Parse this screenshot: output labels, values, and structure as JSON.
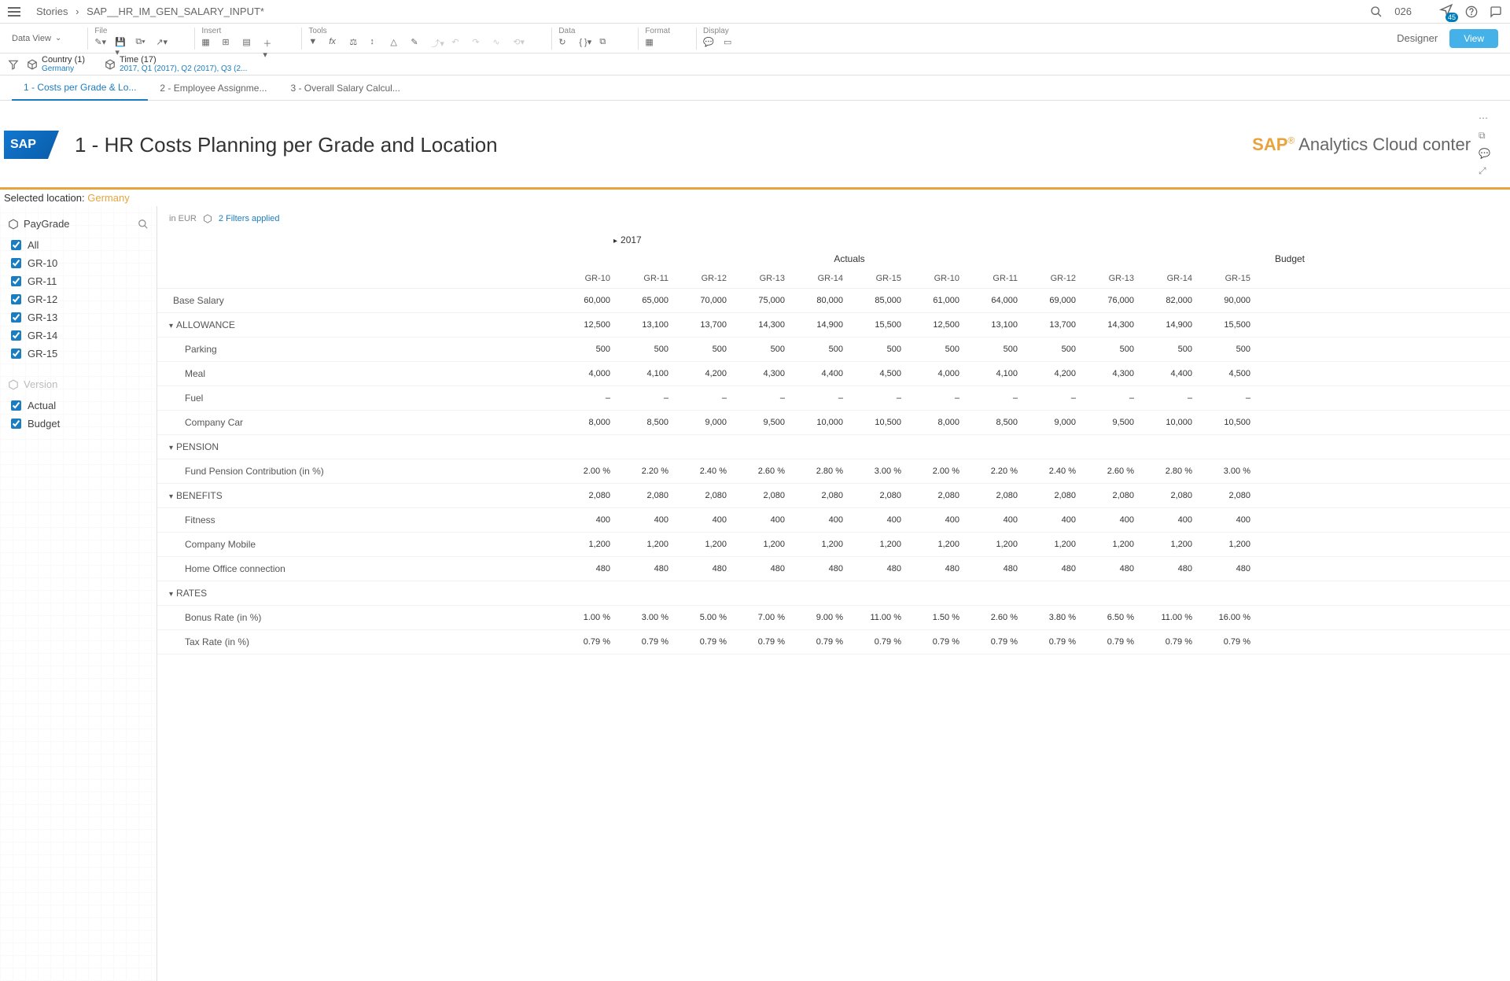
{
  "breadcrumb": {
    "root": "Stories",
    "current": "SAP__HR_IM_GEN_SALARY_INPUT*"
  },
  "search_value": "026",
  "notif_count": "45",
  "toolbar": {
    "data_view": "Data View",
    "groups": {
      "file": "File",
      "insert": "Insert",
      "tools": "Tools",
      "data": "Data",
      "format": "Format",
      "display": "Display"
    },
    "designer": "Designer",
    "view_btn": "View"
  },
  "filters": {
    "country": {
      "label": "Country (1)",
      "value": "Germany"
    },
    "time": {
      "label": "Time (17)",
      "value": "2017, Q1 (2017), Q2 (2017), Q3 (2..."
    }
  },
  "tabs": [
    {
      "label": "1 - Costs per Grade & Lo...",
      "active": true
    },
    {
      "label": "2 - Employee Assignme..."
    },
    {
      "label": "3 - Overall Salary Calcul..."
    }
  ],
  "page": {
    "title": "1 - HR Costs Planning per Grade and Location",
    "brand_suffix": "Analytics Cloud conter",
    "selected_location_label": "Selected location:",
    "selected_location_value": "Germany"
  },
  "sidebar": {
    "paygrade": {
      "title": "PayGrade",
      "items": [
        "All",
        "GR-10",
        "GR-11",
        "GR-12",
        "GR-13",
        "GR-14",
        "GR-15"
      ]
    },
    "version": {
      "title": "Version",
      "items": [
        "Actual",
        "Budget"
      ]
    }
  },
  "grid": {
    "currency": "in EUR",
    "filters_applied": "2 Filters applied",
    "year": "2017",
    "versions": [
      "Actuals",
      "Budget"
    ],
    "grades": [
      "GR-10",
      "GR-11",
      "GR-12",
      "GR-13",
      "GR-14",
      "GR-15",
      "GR-10",
      "GR-11",
      "GR-12",
      "GR-13",
      "GR-14",
      "GR-15"
    ],
    "rows": [
      {
        "label": "Base Salary",
        "type": "plain",
        "cells": [
          "60,000",
          "65,000",
          "70,000",
          "75,000",
          "80,000",
          "85,000",
          "61,000",
          "64,000",
          "69,000",
          "76,000",
          "82,000",
          "90,000"
        ]
      },
      {
        "label": "ALLOWANCE",
        "type": "group",
        "cells": [
          "12,500",
          "13,100",
          "13,700",
          "14,300",
          "14,900",
          "15,500",
          "12,500",
          "13,100",
          "13,700",
          "14,300",
          "14,900",
          "15,500"
        ]
      },
      {
        "label": "Parking",
        "type": "indent",
        "cells": [
          "500",
          "500",
          "500",
          "500",
          "500",
          "500",
          "500",
          "500",
          "500",
          "500",
          "500",
          "500"
        ]
      },
      {
        "label": "Meal",
        "type": "indent",
        "cells": [
          "4,000",
          "4,100",
          "4,200",
          "4,300",
          "4,400",
          "4,500",
          "4,000",
          "4,100",
          "4,200",
          "4,300",
          "4,400",
          "4,500"
        ]
      },
      {
        "label": "Fuel",
        "type": "indent",
        "cells": [
          "–",
          "–",
          "–",
          "–",
          "–",
          "–",
          "–",
          "–",
          "–",
          "–",
          "–",
          "–"
        ]
      },
      {
        "label": "Company Car",
        "type": "indent",
        "cells": [
          "8,000",
          "8,500",
          "9,000",
          "9,500",
          "10,000",
          "10,500",
          "8,000",
          "8,500",
          "9,000",
          "9,500",
          "10,000",
          "10,500"
        ]
      },
      {
        "label": "PENSION",
        "type": "group",
        "cells": [
          "",
          "",
          "",
          "",
          "",
          "",
          "",
          "",
          "",
          "",
          "",
          ""
        ]
      },
      {
        "label": "Fund Pension Contribution (in %)",
        "type": "indent",
        "cells": [
          "2.00 %",
          "2.20 %",
          "2.40 %",
          "2.60 %",
          "2.80 %",
          "3.00 %",
          "2.00 %",
          "2.20 %",
          "2.40 %",
          "2.60 %",
          "2.80 %",
          "3.00 %"
        ]
      },
      {
        "label": "BENEFITS",
        "type": "group",
        "cells": [
          "2,080",
          "2,080",
          "2,080",
          "2,080",
          "2,080",
          "2,080",
          "2,080",
          "2,080",
          "2,080",
          "2,080",
          "2,080",
          "2,080"
        ]
      },
      {
        "label": "Fitness",
        "type": "indent",
        "cells": [
          "400",
          "400",
          "400",
          "400",
          "400",
          "400",
          "400",
          "400",
          "400",
          "400",
          "400",
          "400"
        ]
      },
      {
        "label": "Company Mobile",
        "type": "indent",
        "cells": [
          "1,200",
          "1,200",
          "1,200",
          "1,200",
          "1,200",
          "1,200",
          "1,200",
          "1,200",
          "1,200",
          "1,200",
          "1,200",
          "1,200"
        ]
      },
      {
        "label": "Home Office connection",
        "type": "indent",
        "cells": [
          "480",
          "480",
          "480",
          "480",
          "480",
          "480",
          "480",
          "480",
          "480",
          "480",
          "480",
          "480"
        ]
      },
      {
        "label": "RATES",
        "type": "group",
        "cells": [
          "",
          "",
          "",
          "",
          "",
          "",
          "",
          "",
          "",
          "",
          "",
          ""
        ]
      },
      {
        "label": "Bonus Rate (in %)",
        "type": "indent",
        "cells": [
          "1.00 %",
          "3.00 %",
          "5.00 %",
          "7.00 %",
          "9.00 %",
          "11.00 %",
          "1.50 %",
          "2.60 %",
          "3.80 %",
          "6.50 %",
          "11.00 %",
          "16.00 %"
        ]
      },
      {
        "label": "Tax Rate (in %)",
        "type": "indent",
        "cells": [
          "0.79 %",
          "0.79 %",
          "0.79 %",
          "0.79 %",
          "0.79 %",
          "0.79 %",
          "0.79 %",
          "0.79 %",
          "0.79 %",
          "0.79 %",
          "0.79 %",
          "0.79 %"
        ]
      }
    ]
  }
}
